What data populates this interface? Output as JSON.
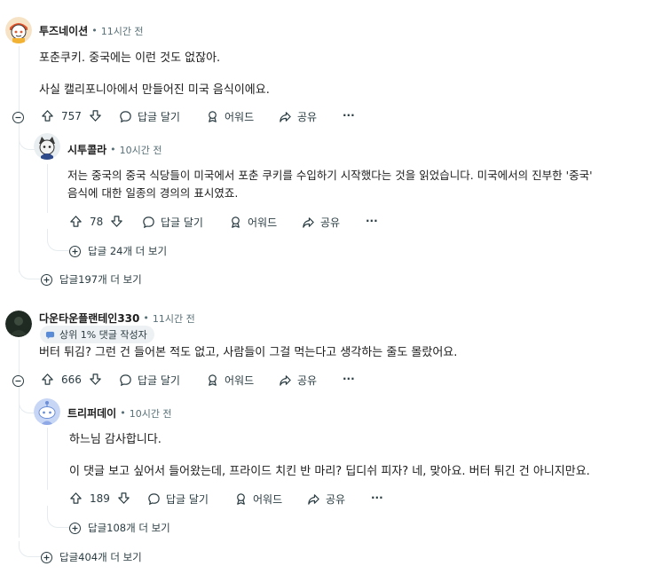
{
  "actions": {
    "reply": "답글 달기",
    "award": "어워드",
    "share": "공유",
    "more": "···"
  },
  "comments": [
    {
      "author": "투즈네이션",
      "time": "11시간 전",
      "lines": [
        "포춘쿠키. 중국에는 이런 것도 없잖아.",
        "사실 캘리포니아에서 만들어진 미국 음식이에요."
      ],
      "votes": "757",
      "more_replies": "답글197개 더 보기",
      "reply": {
        "author": "시투콜라",
        "time": "10시간 전",
        "lines": [
          "저는 중국의 중국 식당들이 미국에서 포춘 쿠키를 수입하기 시작했다는 것을 읽었습니다. 미국에서의 진부한 '중국'",
          "음식에 대한 일종의 경의의 표시였죠."
        ],
        "votes": "78",
        "more_replies": "답글 24개 더 보기"
      }
    },
    {
      "author": "다운타운플랜테인330",
      "time": "11시간 전",
      "badge": "상위 1% 댓글 작성자",
      "lines": [
        "버터 튀김? 그런 건 들어본 적도 없고, 사람들이 그걸 먹는다고 생각하는 줄도 몰랐어요."
      ],
      "votes": "666",
      "more_replies": "답글404개 더 보기",
      "reply": {
        "author": "트리퍼데이",
        "time": "10시간 전",
        "lines": [
          "하느님 감사합니다.",
          "이 댓글 보고 싶어서 들어왔는데, 프라이드 치킨 반 마리? 딥디쉬 피자? 네, 맞아요. 버터 튀긴 건 아니지만요."
        ],
        "votes": "189",
        "more_replies": "답글108개 더 보기"
      }
    }
  ]
}
